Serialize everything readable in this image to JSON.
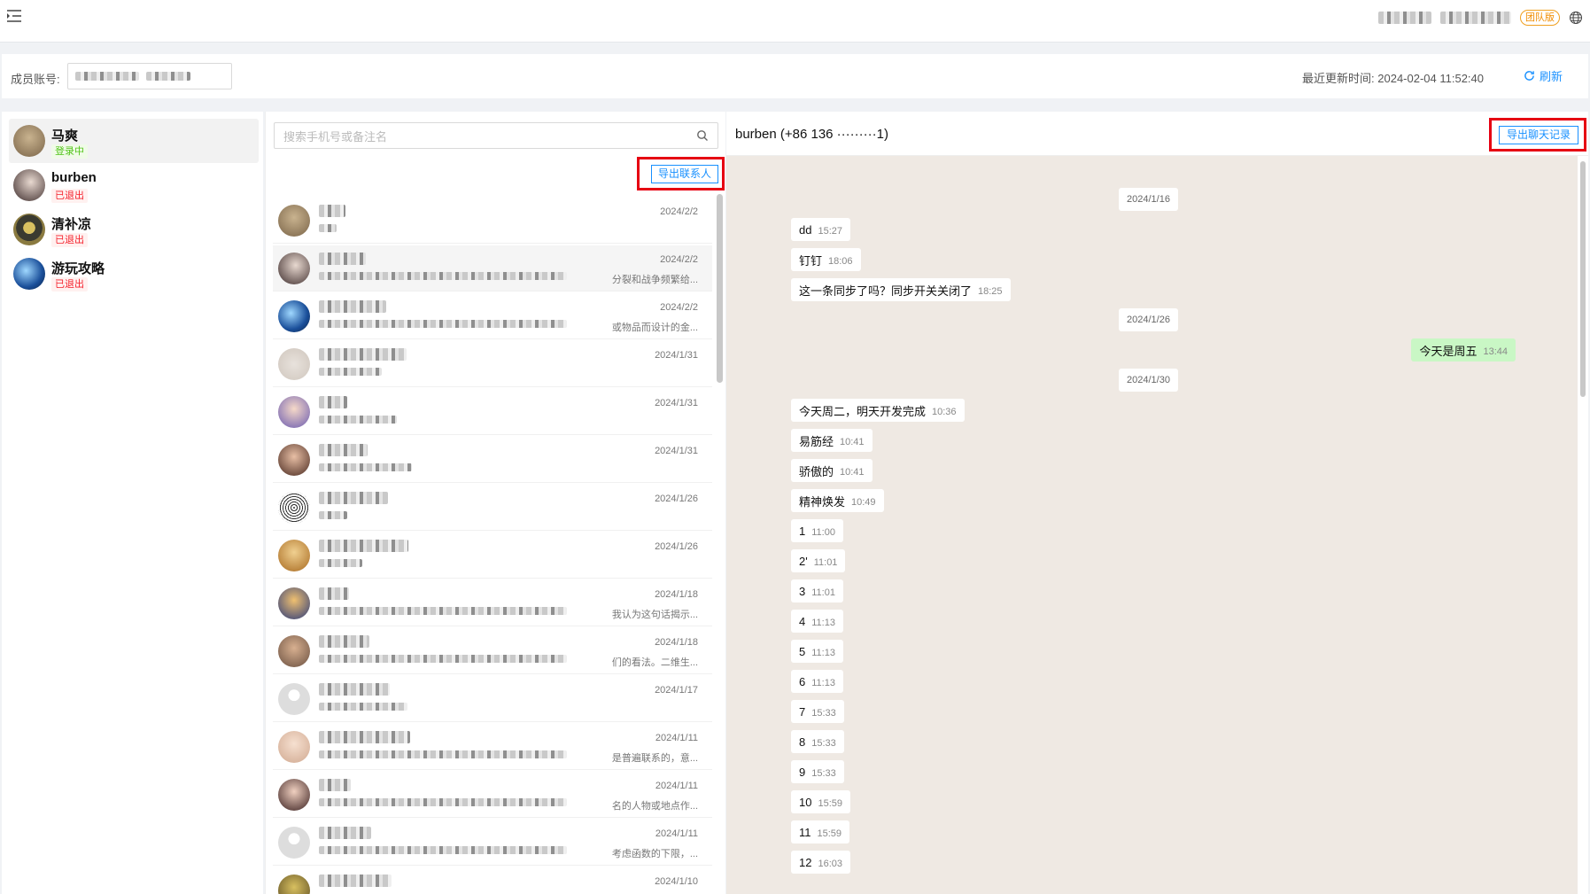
{
  "topbar": {
    "team_badge": "团队版"
  },
  "filter": {
    "member_label": "成员账号:",
    "updated_label": "最近更新时间:",
    "updated_value": "2024-02-04 11:52:40",
    "refresh_label": "刷新"
  },
  "accounts": [
    {
      "name": "马爽",
      "status": "登录中"
    },
    {
      "name": "burben",
      "status": "已退出"
    },
    {
      "name": "清补凉",
      "status": "已退出"
    },
    {
      "name": "游玩攻略",
      "status": "已退出"
    }
  ],
  "contacts_panel": {
    "search_placeholder": "搜索手机号或备注名",
    "export_label": "导出联系人"
  },
  "contacts": [
    {
      "date": "2024/2/2",
      "preview": ""
    },
    {
      "date": "2024/2/2",
      "preview": "分裂和战争频繁给..."
    },
    {
      "date": "2024/2/2",
      "preview": "或物品而设计的金..."
    },
    {
      "date": "2024/1/31",
      "preview": ""
    },
    {
      "date": "2024/1/31",
      "preview": ""
    },
    {
      "date": "2024/1/31",
      "preview": ""
    },
    {
      "date": "2024/1/26",
      "preview": ""
    },
    {
      "date": "2024/1/26",
      "preview": ""
    },
    {
      "date": "2024/1/18",
      "preview": "我认为这句话揭示..."
    },
    {
      "date": "2024/1/18",
      "preview": "们的看法。二维生..."
    },
    {
      "date": "2024/1/17",
      "preview": ""
    },
    {
      "date": "2024/1/11",
      "preview": "是普遍联系的，意..."
    },
    {
      "date": "2024/1/11",
      "preview": "名的人物或地点作..."
    },
    {
      "date": "2024/1/11",
      "preview": "考虑函数的下限，..."
    },
    {
      "date": "2024/1/10",
      "preview": ""
    }
  ],
  "chat": {
    "title": "burben (+86 136 ·········1)",
    "export_label": "导出聊天记录",
    "items": [
      {
        "kind": "date",
        "text": "2024/1/16"
      },
      {
        "kind": "msg",
        "text": "dd",
        "time": "15:27"
      },
      {
        "kind": "msg",
        "text": "钉钉",
        "time": "18:06"
      },
      {
        "kind": "msg",
        "text": "这一条同步了吗？同步开关关闭了",
        "time": "18:25"
      },
      {
        "kind": "date",
        "text": "2024/1/26"
      },
      {
        "kind": "mine",
        "text": "今天是周五",
        "time": "13:44"
      },
      {
        "kind": "date",
        "text": "2024/1/30"
      },
      {
        "kind": "msg",
        "text": "今天周二，明天开发完成",
        "time": "10:36"
      },
      {
        "kind": "msg",
        "text": "易筋经",
        "time": "10:41"
      },
      {
        "kind": "msg",
        "text": "骄傲的",
        "time": "10:41"
      },
      {
        "kind": "msg",
        "text": "精神焕发",
        "time": "10:49"
      },
      {
        "kind": "msg",
        "text": "1",
        "time": "11:00"
      },
      {
        "kind": "msg",
        "text": "2'",
        "time": "11:01"
      },
      {
        "kind": "msg",
        "text": "3",
        "time": "11:01"
      },
      {
        "kind": "msg",
        "text": "4",
        "time": "11:13"
      },
      {
        "kind": "msg",
        "text": "5",
        "time": "11:13"
      },
      {
        "kind": "msg",
        "text": "6",
        "time": "11:13"
      },
      {
        "kind": "msg",
        "text": "7",
        "time": "15:33"
      },
      {
        "kind": "msg",
        "text": "8",
        "time": "15:33"
      },
      {
        "kind": "msg",
        "text": "9",
        "time": "15:33"
      },
      {
        "kind": "msg",
        "text": "10",
        "time": "15:59"
      },
      {
        "kind": "msg",
        "text": "11",
        "time": "15:59"
      },
      {
        "kind": "msg",
        "text": "12",
        "time": "16:03"
      }
    ]
  },
  "colors": {
    "accent": "#1890ff",
    "highlight_box": "#e60012",
    "chat_bg": "#efe9e3",
    "mine_bubble": "#c9f7c5"
  }
}
